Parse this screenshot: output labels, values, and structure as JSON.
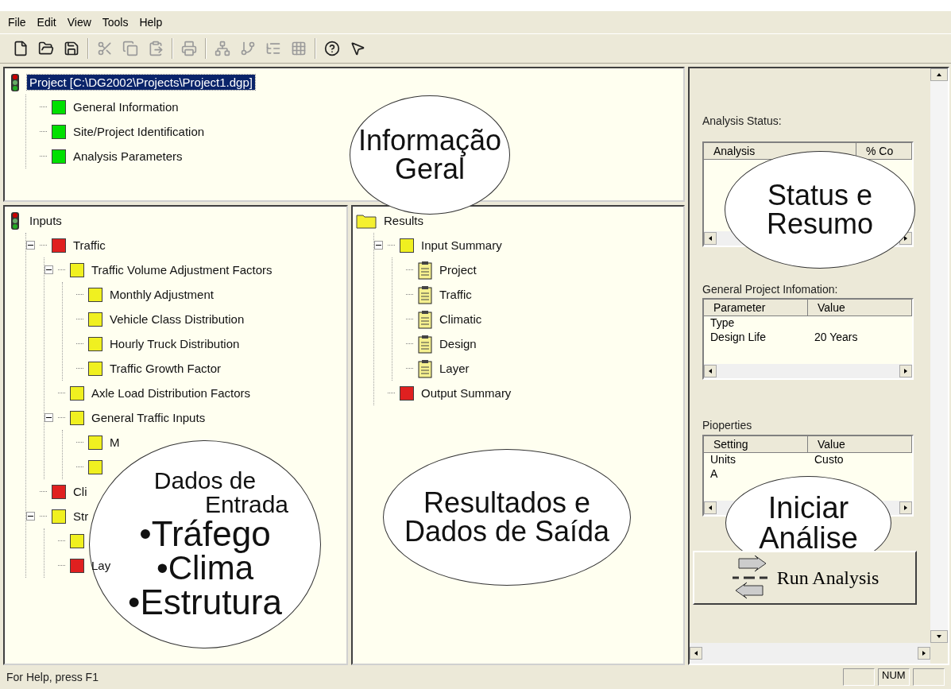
{
  "menu": [
    "File",
    "Edit",
    "View",
    "Tools",
    "Help"
  ],
  "toolbar": [
    {
      "kind": "new",
      "disabled": false
    },
    {
      "kind": "open",
      "disabled": false
    },
    {
      "kind": "save",
      "disabled": false
    },
    {
      "kind": "sep"
    },
    {
      "kind": "cut",
      "disabled": true
    },
    {
      "kind": "copy",
      "disabled": true
    },
    {
      "kind": "paste",
      "disabled": true
    },
    {
      "kind": "sep"
    },
    {
      "kind": "print",
      "disabled": true
    },
    {
      "kind": "sep"
    },
    {
      "kind": "tree1",
      "disabled": true
    },
    {
      "kind": "tree2",
      "disabled": true
    },
    {
      "kind": "tree3",
      "disabled": true
    },
    {
      "kind": "grid",
      "disabled": true
    },
    {
      "kind": "sep"
    },
    {
      "kind": "help",
      "disabled": false
    },
    {
      "kind": "context-help",
      "disabled": false
    }
  ],
  "project_tree": {
    "kind": "traffic-light",
    "label": "Project [C:\\DG2002\\Projects\\Project1.dgp]",
    "selected": true,
    "children": [
      {
        "kind": "square",
        "color": "#00e000",
        "label": "General Information"
      },
      {
        "kind": "square",
        "color": "#00e000",
        "label": "Site/Project Identification"
      },
      {
        "kind": "square",
        "color": "#00e000",
        "label": "Analysis Parameters"
      }
    ]
  },
  "inputs_tree": {
    "kind": "traffic-light",
    "label": "Inputs",
    "children": [
      {
        "kind": "square",
        "color": "#e02020",
        "label": "Traffic",
        "expanded": true,
        "children": [
          {
            "kind": "square",
            "color": "#f0f020",
            "label": "Traffic Volume Adjustment Factors",
            "expanded": true,
            "children": [
              {
                "kind": "square",
                "color": "#f0f020",
                "label": "Monthly Adjustment"
              },
              {
                "kind": "square",
                "color": "#f0f020",
                "label": "Vehicle Class Distribution"
              },
              {
                "kind": "square",
                "color": "#f0f020",
                "label": "Hourly Truck Distribution"
              },
              {
                "kind": "square",
                "color": "#f0f020",
                "label": "Traffic Growth Factor"
              }
            ]
          },
          {
            "kind": "square",
            "color": "#f0f020",
            "label": "Axle Load Distribution Factors"
          },
          {
            "kind": "square",
            "color": "#f0f020",
            "label": "General Traffic Inputs",
            "expanded": true,
            "children": [
              {
                "kind": "square",
                "color": "#f0f020",
                "label": "M"
              },
              {
                "kind": "square",
                "color": "#f0f020"
              }
            ]
          }
        ]
      },
      {
        "kind": "square",
        "color": "#e02020",
        "label": "Cli"
      },
      {
        "kind": "square",
        "color": "#f0f020",
        "label": "Str",
        "expanded": true,
        "children": [
          {
            "kind": "square",
            "color": "#f0f020"
          },
          {
            "kind": "square",
            "color": "#e02020",
            "label": "Lay"
          }
        ]
      }
    ]
  },
  "results_tree": {
    "kind": "folder",
    "label": "Results",
    "children": [
      {
        "kind": "square",
        "color": "#f0f020",
        "label": "Input Summary",
        "expanded": true,
        "children": [
          {
            "kind": "clipboard",
            "label": "Project"
          },
          {
            "kind": "clipboard",
            "label": "Traffic"
          },
          {
            "kind": "clipboard",
            "label": "Climatic"
          },
          {
            "kind": "clipboard",
            "label": "Design"
          },
          {
            "kind": "clipboard",
            "label": "Layer"
          }
        ]
      },
      {
        "kind": "square",
        "color": "#e02020",
        "label": "Output Summary"
      }
    ]
  },
  "side_panel": {
    "analysis_status": {
      "label": "Analysis Status:",
      "columns": [
        "Analysis",
        "% Co"
      ]
    },
    "general_info": {
      "label": "General Project Infomation:",
      "columns": [
        "Parameter",
        "Value"
      ],
      "rows": [
        [
          "Type",
          null
        ],
        [
          "Design Life",
          "20 Years"
        ]
      ]
    },
    "properties": {
      "label": "Pioperties",
      "columns": [
        "Setting",
        "Value"
      ],
      "rows": [
        [
          "Units",
          "Custo"
        ],
        [
          "A",
          null
        ]
      ]
    },
    "run_button": "Run Analysis"
  },
  "callouts": [
    {
      "lines": [
        "Informação",
        "Geral"
      ]
    },
    {
      "lines": [
        "Status e",
        "Resumo"
      ]
    },
    {
      "lines": [
        "Dados de",
        "Entrada",
        "•Tráfego",
        "•Clima",
        "•Estrutura"
      ]
    },
    {
      "lines": [
        "Resultados e",
        "Dados de Saída"
      ]
    },
    {
      "lines": [
        "Iniciar",
        "Análise"
      ]
    }
  ],
  "status_bar": {
    "text": "For Help, press F1",
    "indicators": [
      "NUM"
    ]
  }
}
